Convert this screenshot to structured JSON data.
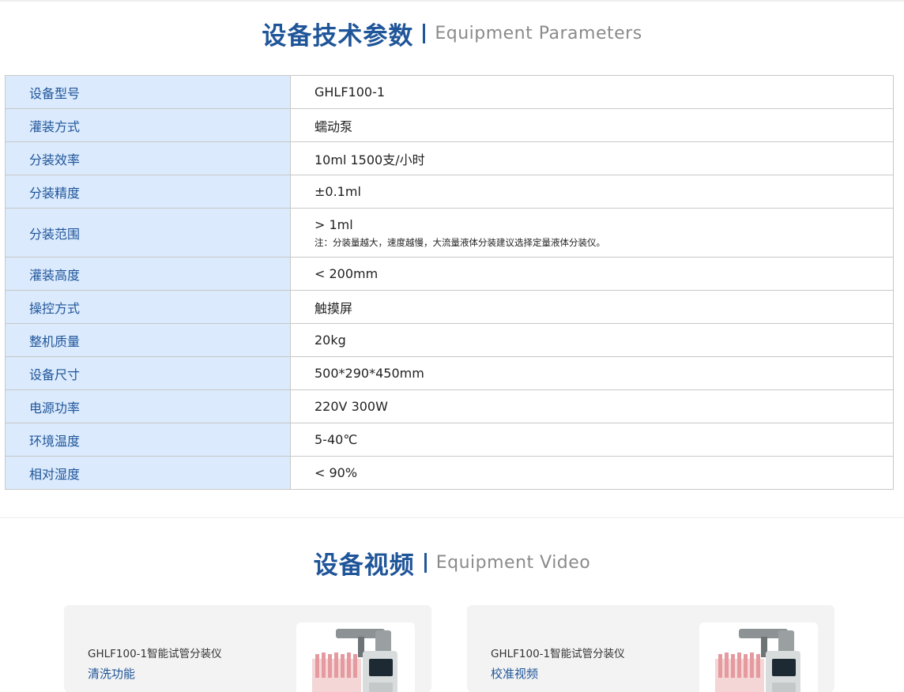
{
  "params_section": {
    "title_zh": "设备技术参数",
    "title_en": "Equipment Parameters",
    "rows": [
      {
        "label": "设备型号",
        "value": "GHLF100-1"
      },
      {
        "label": "灌装方式",
        "value": "蠕动泵"
      },
      {
        "label": "分装效率",
        "value": "10ml 1500支/小时"
      },
      {
        "label": "分装精度",
        "value": "±0.1ml"
      },
      {
        "label": "分装范围",
        "value": "> 1ml",
        "note": "注：分装量越大，速度越慢，大流量液体分装建议选择定量液体分装仪。"
      },
      {
        "label": "灌装高度",
        "value": "< 200mm"
      },
      {
        "label": "操控方式",
        "value": "触摸屏"
      },
      {
        "label": "整机质量",
        "value": "20kg"
      },
      {
        "label": "设备尺寸",
        "value": "500*290*450mm"
      },
      {
        "label": "电源功率",
        "value": "220V 300W"
      },
      {
        "label": "环境温度",
        "value": "5-40℃"
      },
      {
        "label": "相对湿度",
        "value": "< 90%"
      }
    ]
  },
  "video_section": {
    "title_zh": "设备视频",
    "title_en": "Equipment Video",
    "cards": [
      {
        "name": "GHLF100-1智能试管分装仪",
        "subtitle": "清洗功能"
      },
      {
        "name": "GHLF100-1智能试管分装仪",
        "subtitle": "校准视频"
      }
    ]
  },
  "colors": {
    "accent_blue": "#1f5599",
    "label_bg": "#dbeafd",
    "english_gray": "#8a8a8a"
  }
}
